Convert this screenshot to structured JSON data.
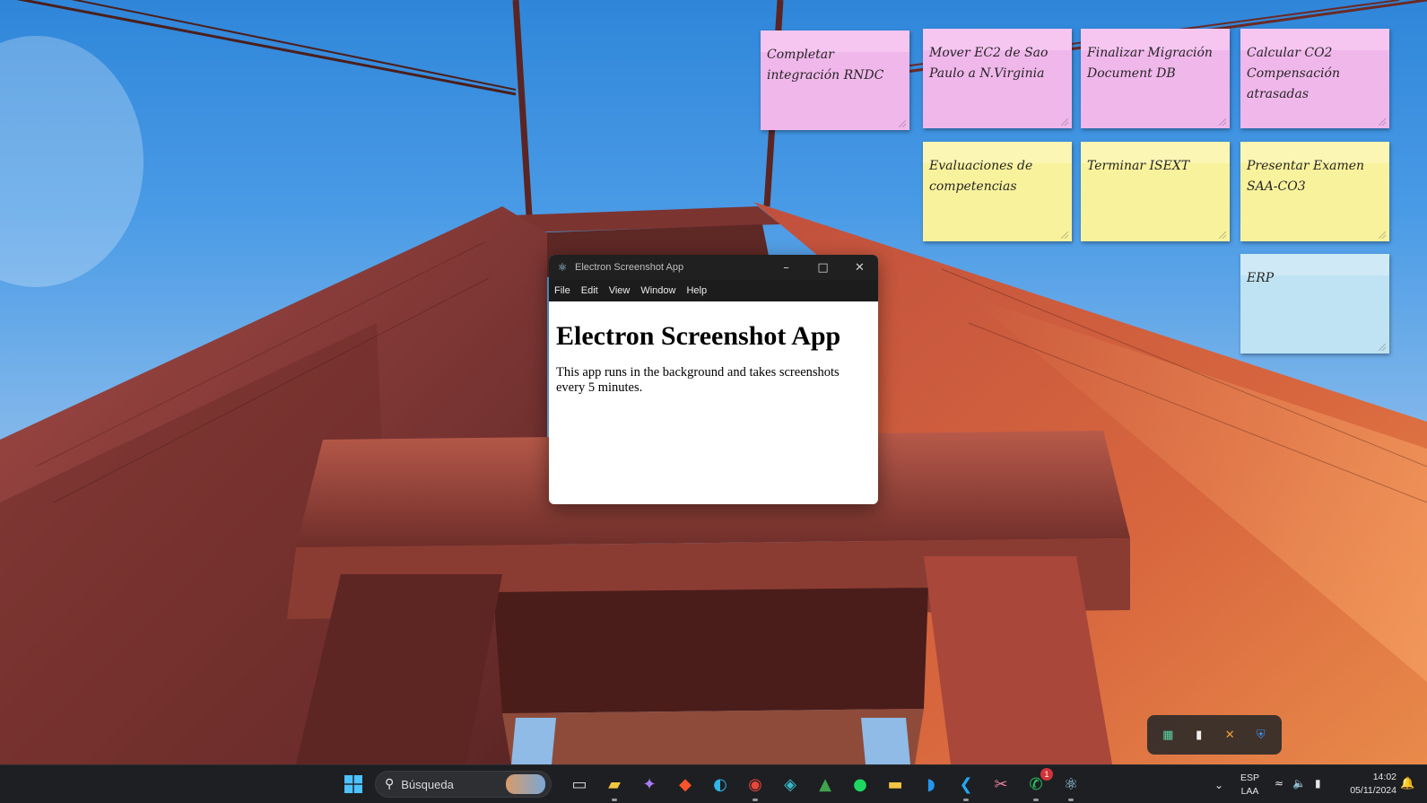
{
  "sticky_notes": [
    {
      "text": "Completar integración RNDC",
      "color": "pink"
    },
    {
      "text": "Mover EC2 de Sao Paulo a N.Virginia",
      "color": "pink"
    },
    {
      "text": "Finalizar Migración Document DB",
      "color": "pink"
    },
    {
      "text": "Calcular CO2 Compensación atrasadas",
      "color": "pink"
    },
    {
      "text": "Evaluaciones de competencias",
      "color": "yellow"
    },
    {
      "text": "Terminar ISEXT",
      "color": "yellow"
    },
    {
      "text": "Presentar Examen SAA-CO3",
      "color": "yellow"
    },
    {
      "text": "ERP",
      "color": "blue"
    }
  ],
  "app_window": {
    "title": "Electron Screenshot App",
    "menu": [
      "File",
      "Edit",
      "View",
      "Window",
      "Help"
    ],
    "heading": "Electron Screenshot App",
    "body": "This app runs in the background and takes screenshots every 5 minutes."
  },
  "tray_flyout": {
    "icons": [
      "color-picker-icon",
      "clipboard-icon",
      "network-tool-icon",
      "defender-warning-icon"
    ]
  },
  "taskbar": {
    "search_placeholder": "Búsqueda",
    "apps": [
      {
        "name": "task-view-icon",
        "glyph": "▭",
        "color": "#d6d6d6",
        "running": false
      },
      {
        "name": "file-explorer-widget-icon",
        "glyph": "▰",
        "color": "#f4c542",
        "running": true
      },
      {
        "name": "copilot-icon",
        "glyph": "✦",
        "color": "#a77bf3",
        "running": false
      },
      {
        "name": "brave-browser-icon",
        "glyph": "◆",
        "color": "#fb542b",
        "running": false
      },
      {
        "name": "edge-browser-icon",
        "glyph": "◐",
        "color": "#2fb5e8",
        "running": false
      },
      {
        "name": "chrome-browser-icon",
        "glyph": "◉",
        "color": "#e8453c",
        "running": true
      },
      {
        "name": "app-cube-icon",
        "glyph": "◈",
        "color": "#38b7c9",
        "running": false
      },
      {
        "name": "mongodb-compass-icon",
        "glyph": "▲",
        "color": "#3fa34d",
        "running": false
      },
      {
        "name": "spotify-icon",
        "glyph": "●",
        "color": "#1ed760",
        "running": false
      },
      {
        "name": "folder-icon",
        "glyph": "▬",
        "color": "#f4c542",
        "running": false
      },
      {
        "name": "docker-icon",
        "glyph": "◗",
        "color": "#2496ed",
        "running": false
      },
      {
        "name": "vscode-icon",
        "glyph": "❮",
        "color": "#23a7f2",
        "running": true
      },
      {
        "name": "snipping-tool-icon",
        "glyph": "✂",
        "color": "#e57f9b",
        "running": false
      },
      {
        "name": "whatsapp-icon",
        "glyph": "✆",
        "color": "#25d366",
        "running": true,
        "badge": "1"
      },
      {
        "name": "electron-app-icon",
        "glyph": "⚛",
        "color": "#9fd3e8",
        "running": true
      }
    ],
    "language": {
      "line1": "ESP",
      "line2": "LAA"
    },
    "time": "14:02",
    "date": "05/11/2024"
  }
}
